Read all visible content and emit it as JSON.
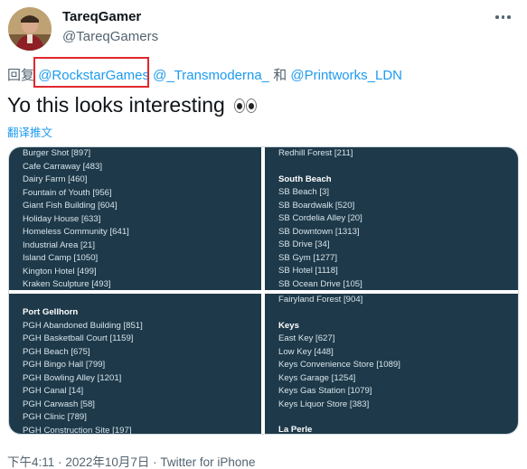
{
  "author": {
    "display_name": "TareqGamer",
    "handle": "@TareqGamers"
  },
  "reply": {
    "prefix": "回复",
    "mention_1": "@RockstarGames",
    "mention_2": "@_Transmoderna_",
    "conjunction": "和",
    "mention_3": "@Printworks_LDN"
  },
  "tweet": {
    "text": "Yo this looks interesting",
    "emoji": "eyes-emoji",
    "translate_label": "翻译推文"
  },
  "media": {
    "top_left": [
      "Burger Shot [897]",
      "Cafe Carraway [483]",
      "Dairy Farm [460]",
      "Fountain of Youth [956]",
      "Giant Fish Building [604]",
      "Holiday House [633]",
      "Homeless Community [641]",
      "Industrial Area [21]",
      "Island Camp [1050]",
      "Kington Hotel [499]",
      "Kraken Sculpture [493]"
    ],
    "top_right_first": "Redhill Forest [211]",
    "top_right_heading": "South Beach",
    "top_right": [
      "SB Beach [3]",
      "SB Boardwalk [520]",
      "SB Cordelia Alley [20]",
      "SB Downtown [1313]",
      "SB Drive [34]",
      "SB Gym [1277]",
      "SB Hotel [1118]",
      "SB Ocean Drive [105]"
    ],
    "bottom_left_heading": "Port Gellhorn",
    "bottom_left": [
      "PGH Abandoned Building [851]",
      "PGH Basketball Court [1159]",
      "PGH Beach [675]",
      "PGH Bingo Hall [799]",
      "PGH Bowling Alley [1201]",
      "PGH Canal [14]",
      "PGH Carwash [58]",
      "PGH Clinic [789]",
      "PGH Construction Site [197]"
    ],
    "bottom_right_first": "Fairyland Forest [904]",
    "bottom_right_heading": "Keys",
    "bottom_right": [
      "East Key [627]",
      "Low Key [448]",
      "Keys Convenience Store [1089]",
      "Keys Garage [1254]",
      "Keys Gas Station [1079]",
      "Keys Liquor Store [383]"
    ],
    "bottom_right_heading_2": "La Perle"
  },
  "footer": {
    "time": "下午4:11",
    "separator": "·",
    "date": "2022年10月7日",
    "source": "Twitter for iPhone"
  },
  "colors": {
    "link": "#1d9bf0",
    "panel_bg": "#1e3a4a",
    "highlight_box": "#e0282e"
  }
}
